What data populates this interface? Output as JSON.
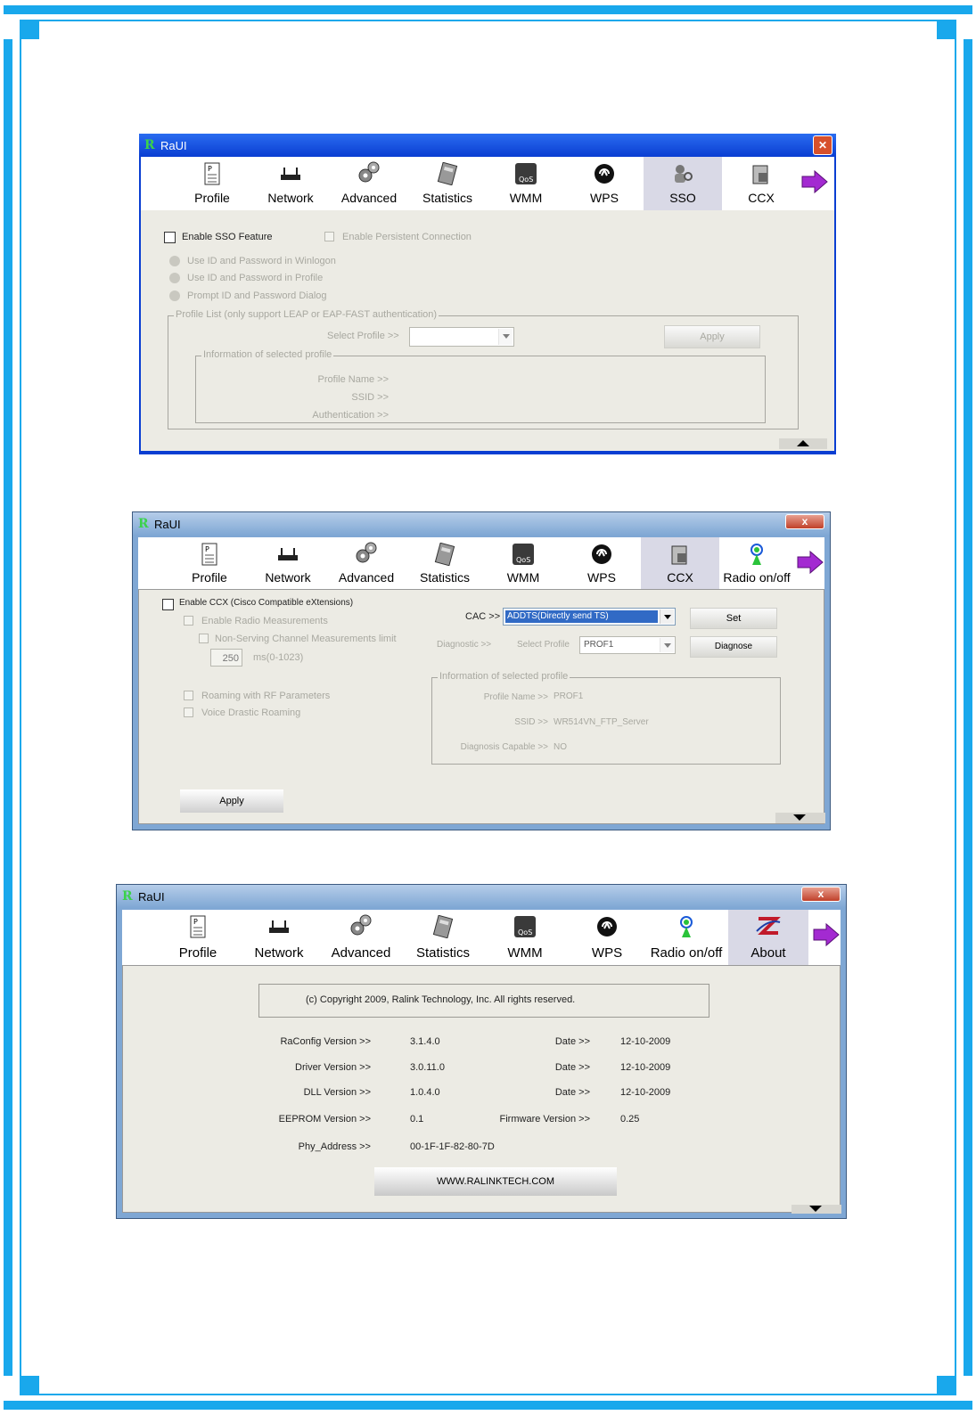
{
  "window1": {
    "title": "RaUI",
    "logo": "R",
    "tabs": [
      {
        "label": "Profile",
        "icon": "profile-icon"
      },
      {
        "label": "Network",
        "icon": "network-icon"
      },
      {
        "label": "Advanced",
        "icon": "advanced-icon"
      },
      {
        "label": "Statistics",
        "icon": "statistics-icon"
      },
      {
        "label": "WMM",
        "icon": "wmm-icon"
      },
      {
        "label": "WPS",
        "icon": "wps-icon"
      },
      {
        "label": "SSO",
        "icon": "sso-icon"
      },
      {
        "label": "CCX",
        "icon": "ccx-icon"
      }
    ],
    "enable_sso": "Enable SSO Feature",
    "enable_persistent": "Enable Persistent Connection",
    "radio_winlogon": "Use ID and Password in Winlogon",
    "radio_profile": "Use ID and Password in Profile",
    "radio_prompt": "Prompt ID and Password Dialog",
    "profile_list_group": "Profile List (only support LEAP or EAP-FAST authentication)",
    "select_profile": "Select Profile >>",
    "apply": "Apply",
    "info_group": "Information of selected profile",
    "profile_name": "Profile Name >>",
    "ssid": "SSID >>",
    "authentication": "Authentication >>"
  },
  "window2": {
    "title": "RaUI",
    "logo": "R",
    "tabs": [
      {
        "label": "Profile",
        "icon": "profile-icon"
      },
      {
        "label": "Network",
        "icon": "network-icon"
      },
      {
        "label": "Advanced",
        "icon": "advanced-icon"
      },
      {
        "label": "Statistics",
        "icon": "statistics-icon"
      },
      {
        "label": "WMM",
        "icon": "wmm-icon"
      },
      {
        "label": "WPS",
        "icon": "wps-icon"
      },
      {
        "label": "CCX",
        "icon": "ccx-icon"
      },
      {
        "label": "Radio on/off",
        "icon": "radio-icon"
      }
    ],
    "close": "x",
    "enable_ccx": "Enable CCX (Cisco Compatible eXtensions)",
    "enable_radio_meas": "Enable Radio Measurements",
    "non_serving": "Non-Serving Channel Measurements limit",
    "limit_value": "250",
    "limit_unit": "ms(0-1023)",
    "roaming_rf": "Roaming with RF Parameters",
    "voice_roaming": "Voice Drastic Roaming",
    "cac_label": "CAC >>",
    "cac_value": "ADDTS(Directly send TS)",
    "set": "Set",
    "diagnostic": "Diagnostic >>",
    "select_profile": "Select Profile",
    "profile_value": "PROF1",
    "diagnose": "Diagnose",
    "info_group": "Information of selected profile",
    "profile_name_label": "Profile Name >>",
    "profile_name_value": "PROF1",
    "ssid_label": "SSID >>",
    "ssid_value": "WR514VN_FTP_Server",
    "diag_capable_label": "Diagnosis Capable >>",
    "diag_capable_value": "NO",
    "apply": "Apply"
  },
  "window3": {
    "title": "RaUI",
    "logo": "R",
    "close": "x",
    "tabs": [
      {
        "label": "Profile",
        "icon": "profile-icon"
      },
      {
        "label": "Network",
        "icon": "network-icon"
      },
      {
        "label": "Advanced",
        "icon": "advanced-icon"
      },
      {
        "label": "Statistics",
        "icon": "statistics-icon"
      },
      {
        "label": "WMM",
        "icon": "wmm-icon"
      },
      {
        "label": "WPS",
        "icon": "wps-icon"
      },
      {
        "label": "Radio on/off",
        "icon": "radio-icon"
      },
      {
        "label": "About",
        "icon": "about-icon"
      }
    ],
    "copyright": "(c) Copyright 2009, Ralink Technology, Inc.  All rights reserved.",
    "rows": [
      {
        "label": "RaConfig Version >>",
        "value": "3.1.4.0",
        "label2": "Date >>",
        "value2": "12-10-2009"
      },
      {
        "label": "Driver Version >>",
        "value": "3.0.11.0",
        "label2": "Date >>",
        "value2": "12-10-2009"
      },
      {
        "label": "DLL Version >>",
        "value": "1.0.4.0",
        "label2": "Date >>",
        "value2": "12-10-2009"
      },
      {
        "label": "EEPROM Version >>",
        "value": "0.1",
        "label2": "Firmware Version >>",
        "value2": "0.25"
      },
      {
        "label": "Phy_Address >>",
        "value": "00-1F-1F-82-80-7D",
        "label2": "",
        "value2": ""
      }
    ],
    "website": "WWW.RALINKTECH.COM"
  },
  "colors": {
    "page_border": "#19a8ec",
    "xp_title": "#0a3ed2",
    "vista_title": "#7fa7d4",
    "selected_tab": "#d9d9e6",
    "content_bg": "#ecebe4",
    "arrow_purple": "#a32ad1"
  }
}
